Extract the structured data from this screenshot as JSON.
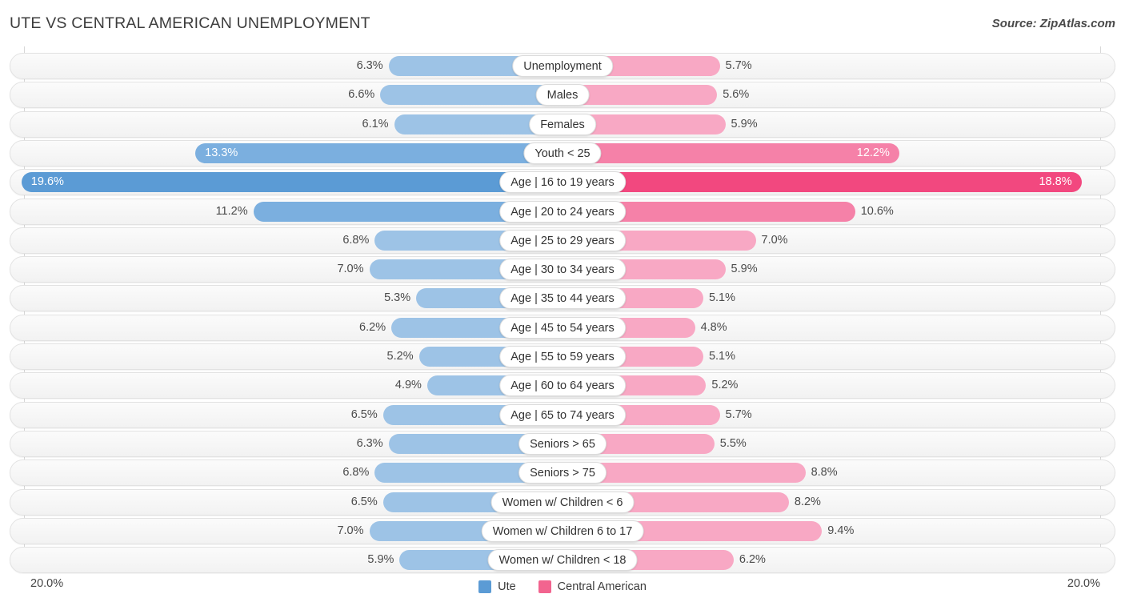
{
  "header": {
    "title": "UTE VS CENTRAL AMERICAN UNEMPLOYMENT",
    "source": "Source: ZipAtlas.com"
  },
  "axis": {
    "left_label": "20.0%",
    "right_label": "20.0%",
    "max": 20.0
  },
  "legend": {
    "items": [
      {
        "label": "Ute",
        "color": "#5b9bd5"
      },
      {
        "label": "Central American",
        "color": "#f2648f"
      }
    ]
  },
  "colors": {
    "left_light": "#9dc3e6",
    "left_mid": "#7bafdf",
    "left_dark": "#5b9bd5",
    "right_light": "#f8a8c4",
    "right_mid": "#f581a8",
    "right_dark": "#f2487f",
    "track_border": "#e2e2e2",
    "gridline": "#d8d8d8"
  },
  "chart_data": {
    "type": "bar",
    "subtype": "diverging-bidirectional",
    "title": "UTE VS CENTRAL AMERICAN UNEMPLOYMENT",
    "xlabel": "",
    "ylabel": "",
    "unit": "%",
    "xlim": [
      20.0,
      20.0
    ],
    "grid": true,
    "legend_position": "bottom-center",
    "categories": [
      "Unemployment",
      "Males",
      "Females",
      "Youth < 25",
      "Age | 16 to 19 years",
      "Age | 20 to 24 years",
      "Age | 25 to 29 years",
      "Age | 30 to 34 years",
      "Age | 35 to 44 years",
      "Age | 45 to 54 years",
      "Age | 55 to 59 years",
      "Age | 60 to 64 years",
      "Age | 65 to 74 years",
      "Seniors > 65",
      "Seniors > 75",
      "Women w/ Children < 6",
      "Women w/ Children 6 to 17",
      "Women w/ Children < 18"
    ],
    "series": [
      {
        "name": "Ute",
        "color": "#5b9bd5",
        "direction": "left",
        "values": [
          6.3,
          6.6,
          6.1,
          13.3,
          19.6,
          11.2,
          6.8,
          7.0,
          5.3,
          6.2,
          5.2,
          4.9,
          6.5,
          6.3,
          6.8,
          6.5,
          7.0,
          5.9
        ],
        "labels": [
          "6.3%",
          "6.6%",
          "6.1%",
          "13.3%",
          "19.6%",
          "11.2%",
          "6.8%",
          "7.0%",
          "5.3%",
          "6.2%",
          "5.2%",
          "4.9%",
          "6.5%",
          "6.3%",
          "6.8%",
          "6.5%",
          "7.0%",
          "5.9%"
        ]
      },
      {
        "name": "Central American",
        "color": "#f2648f",
        "direction": "right",
        "values": [
          5.7,
          5.6,
          5.9,
          12.2,
          18.8,
          10.6,
          7.0,
          5.9,
          5.1,
          4.8,
          5.1,
          5.2,
          5.7,
          5.5,
          8.8,
          8.2,
          9.4,
          6.2
        ],
        "labels": [
          "5.7%",
          "5.6%",
          "5.9%",
          "12.2%",
          "18.8%",
          "10.6%",
          "7.0%",
          "5.9%",
          "5.1%",
          "4.8%",
          "5.1%",
          "5.2%",
          "5.7%",
          "5.5%",
          "8.8%",
          "8.2%",
          "9.4%",
          "6.2%"
        ]
      }
    ]
  }
}
